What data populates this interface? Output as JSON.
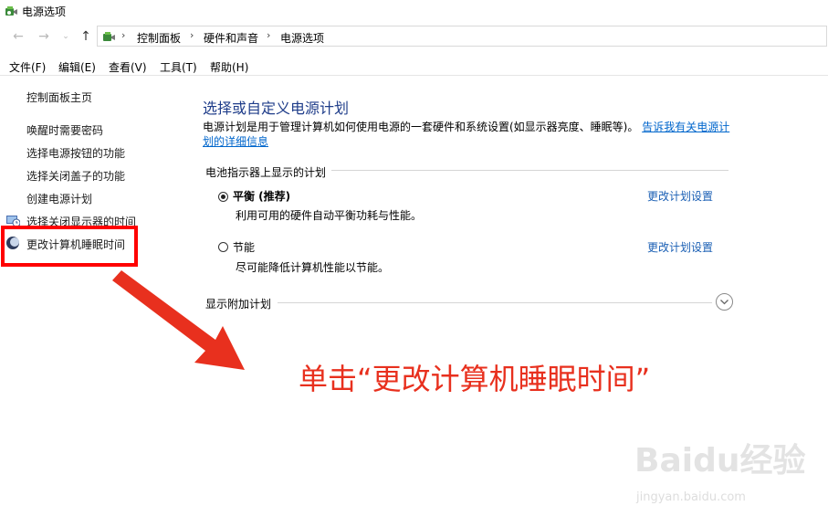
{
  "window": {
    "title": "电源选项"
  },
  "address": {
    "crumbs": [
      "控制面板",
      "硬件和声音",
      "电源选项"
    ]
  },
  "menubar": {
    "items": [
      "文件(F)",
      "编辑(E)",
      "查看(V)",
      "工具(T)",
      "帮助(H)"
    ]
  },
  "sidebar": {
    "home": "控制面板主页",
    "items": [
      {
        "label": "唤醒时需要密码"
      },
      {
        "label": "选择电源按钮的功能"
      },
      {
        "label": "选择关闭盖子的功能"
      },
      {
        "label": "创建电源计划"
      },
      {
        "label": "选择关闭显示器的时间"
      },
      {
        "label": "更改计算机睡眠时间"
      }
    ]
  },
  "main": {
    "title": "选择或自定义电源计划",
    "description": "电源计划是用于管理计算机如何使用电源的一套硬件和系统设置(如显示器亮度、睡眠等)。",
    "description_link": "告诉我有关电源计划的详细信息",
    "battery_section_label": "电池指示器上显示的计划",
    "plans": [
      {
        "name": "平衡 (推荐)",
        "description": "利用可用的硬件自动平衡功耗与性能。",
        "selected": true,
        "link": "更改计划设置"
      },
      {
        "name": "节能",
        "description": "尽可能降低计算机性能以节能。",
        "selected": false,
        "link": "更改计划设置"
      }
    ],
    "additional_plans_label": "显示附加计划"
  },
  "annotation": {
    "text": "单击“更改计算机睡眠时间”"
  },
  "watermark": {
    "logo": "Baidu经验",
    "url": "jingyan.baidu.com"
  },
  "colors": {
    "accent_link": "#1a5fb4",
    "annotation_red": "#e8301e",
    "title_blue": "#1f3d8a"
  }
}
